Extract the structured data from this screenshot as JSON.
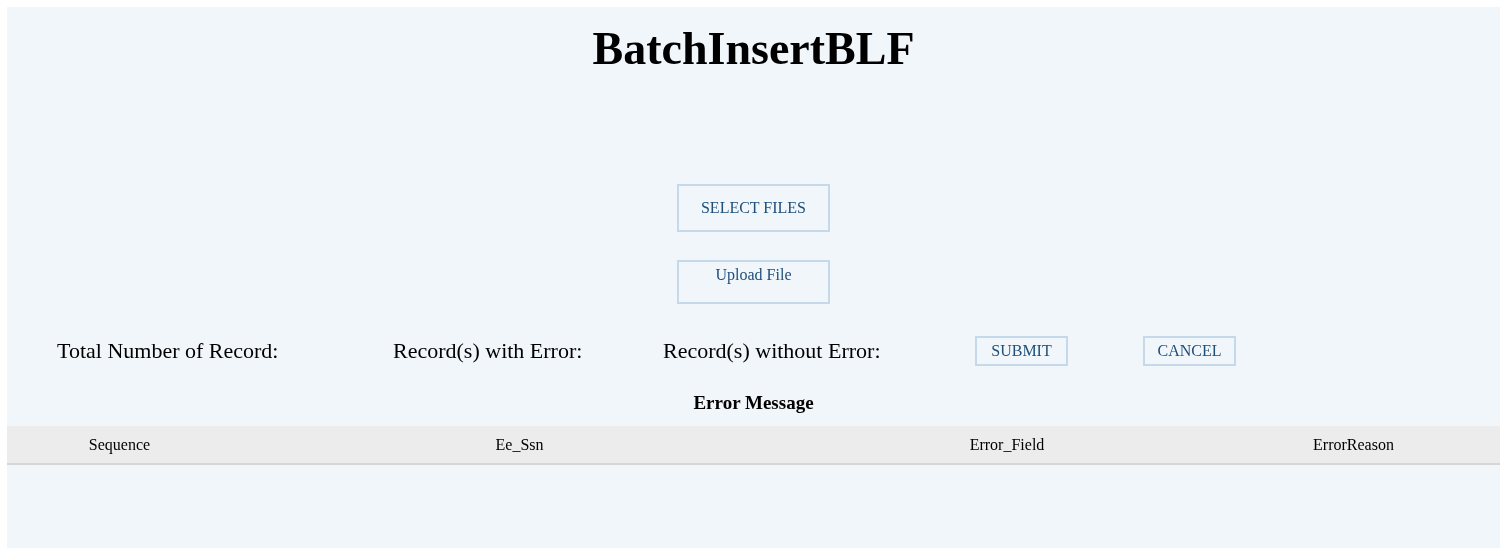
{
  "title": "BatchInsertBLF",
  "file_buttons": [
    "SELECT FILES",
    "Upload File"
  ],
  "summary": {
    "labels": [
      "Total Number of Record:",
      "Record(s) with Error:",
      "Record(s) without Error:"
    ],
    "buttons": [
      "SUBMIT",
      "CANCEL"
    ]
  },
  "error_table": {
    "title": "Error Message",
    "columns": [
      "Sequence",
      "Ee_Ssn",
      "Error_Field",
      "ErrorReason"
    ]
  }
}
